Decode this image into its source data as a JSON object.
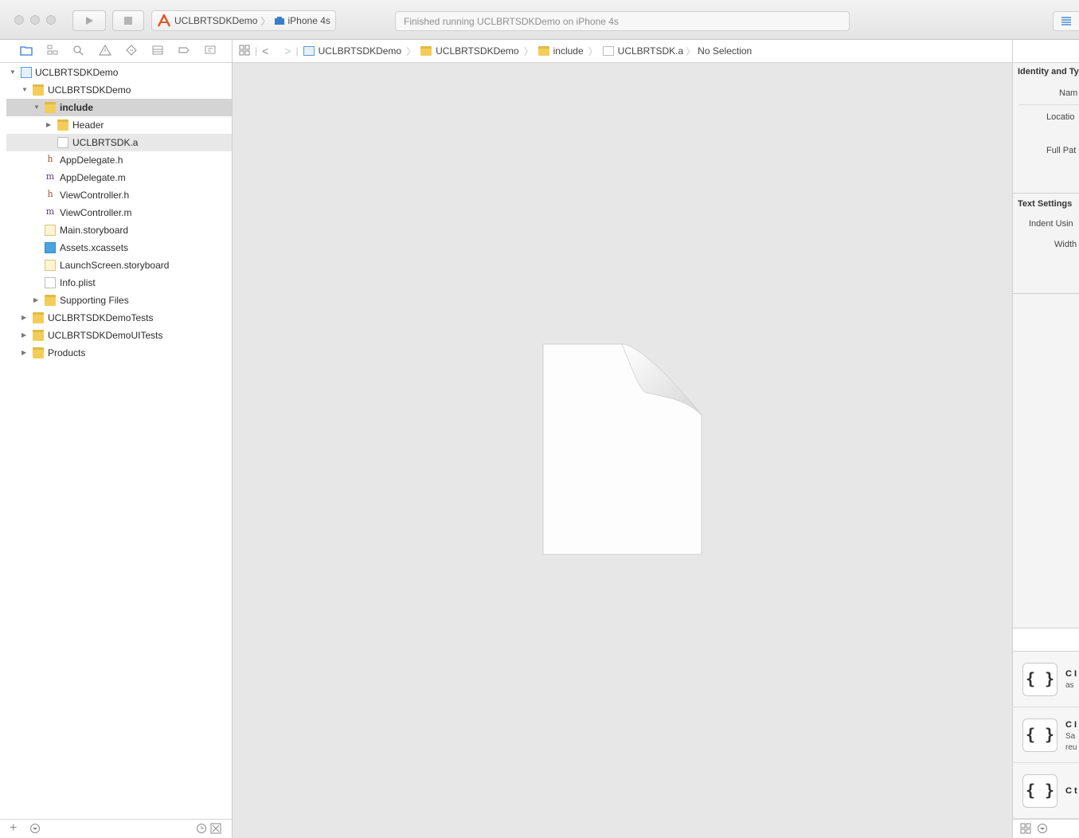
{
  "toolbar": {
    "scheme_name": "UCLBRTSDKDemo",
    "device_name": "iPhone 4s",
    "status_text": "Finished running UCLBRTSDKDemo on iPhone 4s"
  },
  "navigator": {
    "tabs": [
      "folder-icon",
      "hierarchy-icon",
      "search-icon",
      "warning-icon",
      "test-icon",
      "debug-icon",
      "breakpoint-icon",
      "report-icon"
    ],
    "items": [
      {
        "label": "UCLBRTSDKDemo",
        "icon": "project-icon"
      },
      {
        "label": "UCLBRTSDKDemo",
        "icon": "folder-icon"
      },
      {
        "label": "include",
        "icon": "folder-icon"
      },
      {
        "label": "Header",
        "icon": "folder-icon"
      },
      {
        "label": "UCLBRTSDK.a",
        "icon": "library-file-icon"
      },
      {
        "label": "AppDelegate.h",
        "icon": "header-file-icon",
        "glyph": "h"
      },
      {
        "label": "AppDelegate.m",
        "icon": "source-file-icon",
        "glyph": "m"
      },
      {
        "label": "ViewController.h",
        "icon": "header-file-icon",
        "glyph": "h"
      },
      {
        "label": "ViewController.m",
        "icon": "source-file-icon",
        "glyph": "m"
      },
      {
        "label": "Main.storyboard",
        "icon": "storyboard-icon"
      },
      {
        "label": "Assets.xcassets",
        "icon": "assets-icon"
      },
      {
        "label": "LaunchScreen.storyboard",
        "icon": "storyboard-icon"
      },
      {
        "label": "Info.plist",
        "icon": "plist-icon"
      },
      {
        "label": "Supporting Files",
        "icon": "folder-icon"
      },
      {
        "label": "UCLBRTSDKDemoTests",
        "icon": "folder-icon"
      },
      {
        "label": "UCLBRTSDKDemoUITests",
        "icon": "folder-icon"
      },
      {
        "label": "Products",
        "icon": "folder-icon"
      }
    ]
  },
  "jumpbar": {
    "crumbs": [
      "UCLBRTSDKDemo",
      "UCLBRTSDKDemo",
      "include",
      "UCLBRTSDK.a"
    ],
    "selection": "No Selection"
  },
  "inspector": {
    "identity_title": "Identity and Ty",
    "name_label": "Nam",
    "location_label": "Locatio",
    "full_path_label": "Full Pat",
    "text_settings_title": "Text Settings",
    "indent_label": "Indent Usin",
    "width_label": "Width",
    "snippets": [
      {
        "glyph": "{ }",
        "title": "C I",
        "desc": "as"
      },
      {
        "glyph": "{ }",
        "title": "C I",
        "desc": "Sa",
        "desc2": "reu"
      },
      {
        "glyph": "{ }",
        "title": "C t",
        "desc": ""
      }
    ]
  },
  "colors": {
    "accent": "#2f7bd8",
    "folder": "#f3cd5a",
    "editor_bg": "#e7e7e7"
  }
}
